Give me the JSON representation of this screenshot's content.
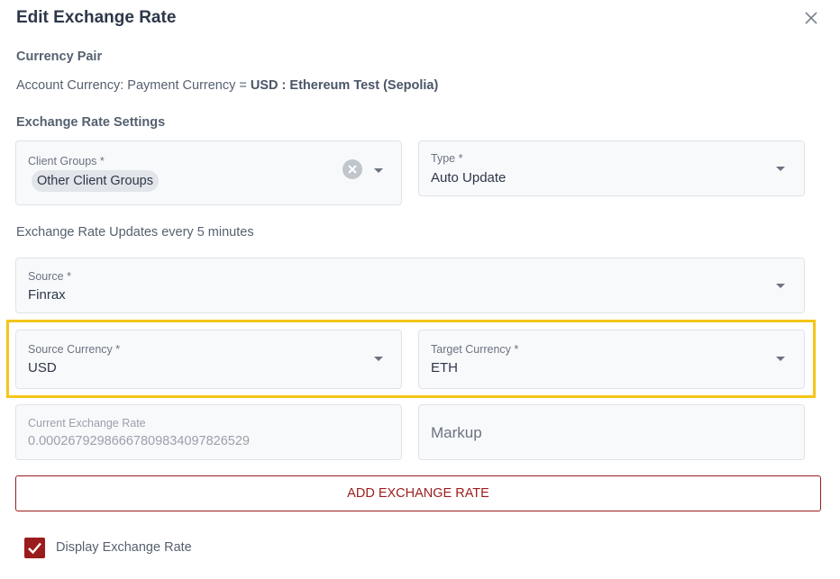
{
  "dialog": {
    "title": "Edit Exchange Rate",
    "close_icon": "close-icon"
  },
  "currency_pair": {
    "heading": "Currency Pair",
    "prefix": "Account Currency: Payment Currency = ",
    "value": "USD : Ethereum Test (Sepolia)"
  },
  "settings": {
    "heading": "Exchange Rate Settings",
    "client_groups": {
      "label": "Client Groups *",
      "chips": [
        "Other Client Groups"
      ],
      "clear_icon": "clear-icon",
      "dropdown_icon": "chevron-down-icon"
    },
    "type": {
      "label": "Type *",
      "value": "Auto Update"
    },
    "update_info": "Exchange Rate Updates every 5 minutes",
    "source": {
      "label": "Source *",
      "value": "Finrax"
    },
    "source_currency": {
      "label": "Source Currency *",
      "value": "USD"
    },
    "target_currency": {
      "label": "Target Currency *",
      "value": "ETH"
    },
    "current_rate": {
      "label": "Current Exchange Rate",
      "value": "0.00026792986667809834097826529"
    },
    "markup": {
      "placeholder": "Markup"
    }
  },
  "add_button": {
    "label": "ADD EXCHANGE RATE"
  },
  "display_rate": {
    "label": "Display Exchange Rate",
    "checked": true
  },
  "colors": {
    "accent": "#9b1c1c",
    "highlight": "#f5c518",
    "field_bg": "#f8f9fb",
    "border": "#dfe3e8"
  }
}
